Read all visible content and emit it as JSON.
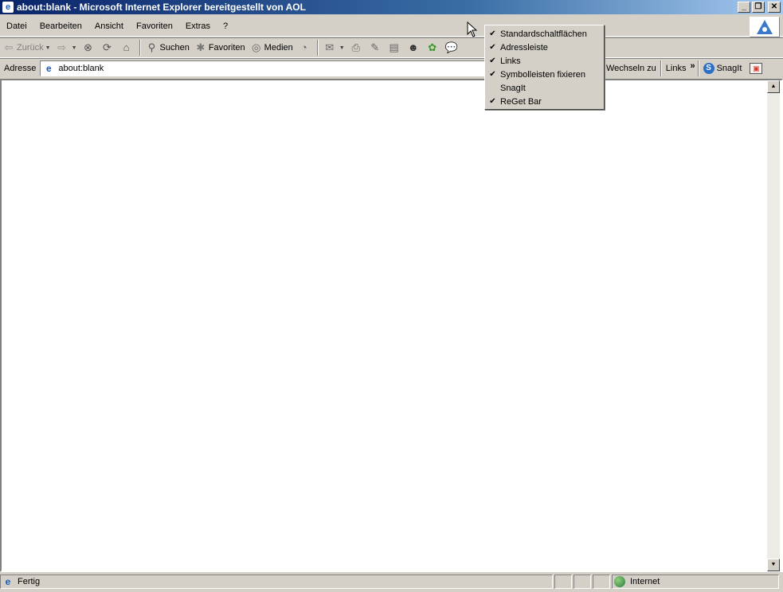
{
  "window": {
    "title": "about:blank - Microsoft Internet Explorer bereitgestellt von AOL",
    "controls": {
      "minimize": "_",
      "restore": "❐",
      "close": "✕"
    }
  },
  "menu": [
    "Datei",
    "Bearbeiten",
    "Ansicht",
    "Favoriten",
    "Extras",
    "?"
  ],
  "toolbar": {
    "back_label": "Zurück",
    "search_label": "Suchen",
    "favorites_label": "Favoriten",
    "media_label": "Medien"
  },
  "address": {
    "label": "Adresse",
    "value": "about:blank",
    "go_label": "Wechseln zu",
    "links_label": "Links",
    "chevron": "»",
    "snagit_label": "SnagIt"
  },
  "context_menu": {
    "items": [
      {
        "label": "Standardschaltflächen",
        "check": "✔"
      },
      {
        "label": "Adressleiste",
        "check": "✔"
      },
      {
        "label": "Links",
        "check": "✔"
      },
      {
        "label": "Symbolleisten fixieren",
        "check": "✔"
      },
      {
        "label": "SnagIt",
        "check": ""
      },
      {
        "label": "ReGet Bar",
        "check": "✔"
      }
    ]
  },
  "status": {
    "text": "Fertig",
    "zone": "Internet"
  },
  "colors": {
    "titlebar_start": "#0a246a",
    "titlebar_end": "#a6caf0",
    "chrome": "#d4d0c8",
    "content": "#ffffff"
  },
  "icons": {
    "back": "arrow-left-icon",
    "forward": "arrow-right-icon",
    "stop": "stop-icon",
    "refresh": "refresh-icon",
    "home": "home-icon",
    "search": "search-icon",
    "favorites": "favorites-icon",
    "media": "media-icon",
    "history": "history-icon",
    "mail": "mail-icon",
    "print": "print-icon",
    "edit": "edit-icon",
    "discuss": "discuss-icon",
    "messenger": "messenger-icon",
    "icq": "icq-icon",
    "chat": "chat-icon"
  }
}
